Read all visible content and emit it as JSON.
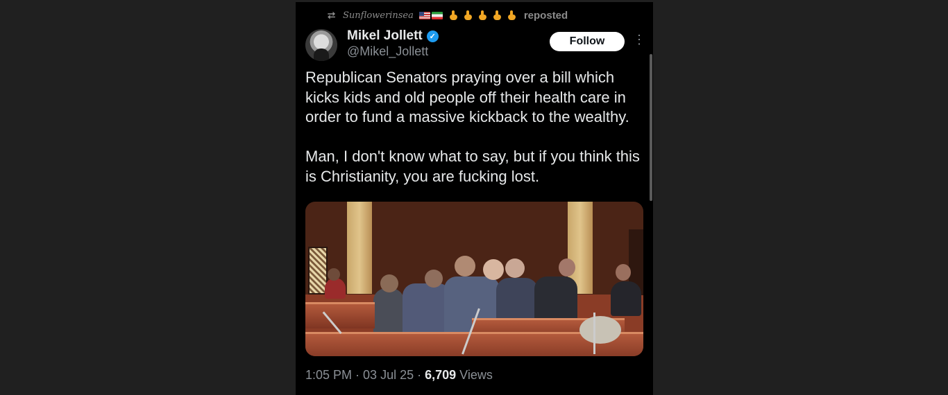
{
  "repost": {
    "user": "Sunflowerinsea",
    "label": "reposted"
  },
  "author": {
    "display_name": "Mikel Jollett",
    "handle": "@Mikel_Jollett",
    "verified": true
  },
  "follow_label": "Follow",
  "tweet_text": "Republican Senators praying over a bill which kicks kids and old people off their health care in order to fund a massive kickback to the wealthy.\n\nMan, I don't know what to say, but if you think this is Christianity, you are fucking lost.",
  "meta": {
    "time": "1:05 PM",
    "separator": "·",
    "date": "03 Jul 25",
    "views_count": "6,709",
    "views_label": "Views"
  },
  "colors": {
    "background": "#202020",
    "panel": "#000000",
    "text": "#e7e9ea",
    "secondary": "#8b9096",
    "verified": "#1d9bf0"
  },
  "icons": [
    "repost-icon",
    "verified-badge-icon",
    "more-options-icon"
  ]
}
